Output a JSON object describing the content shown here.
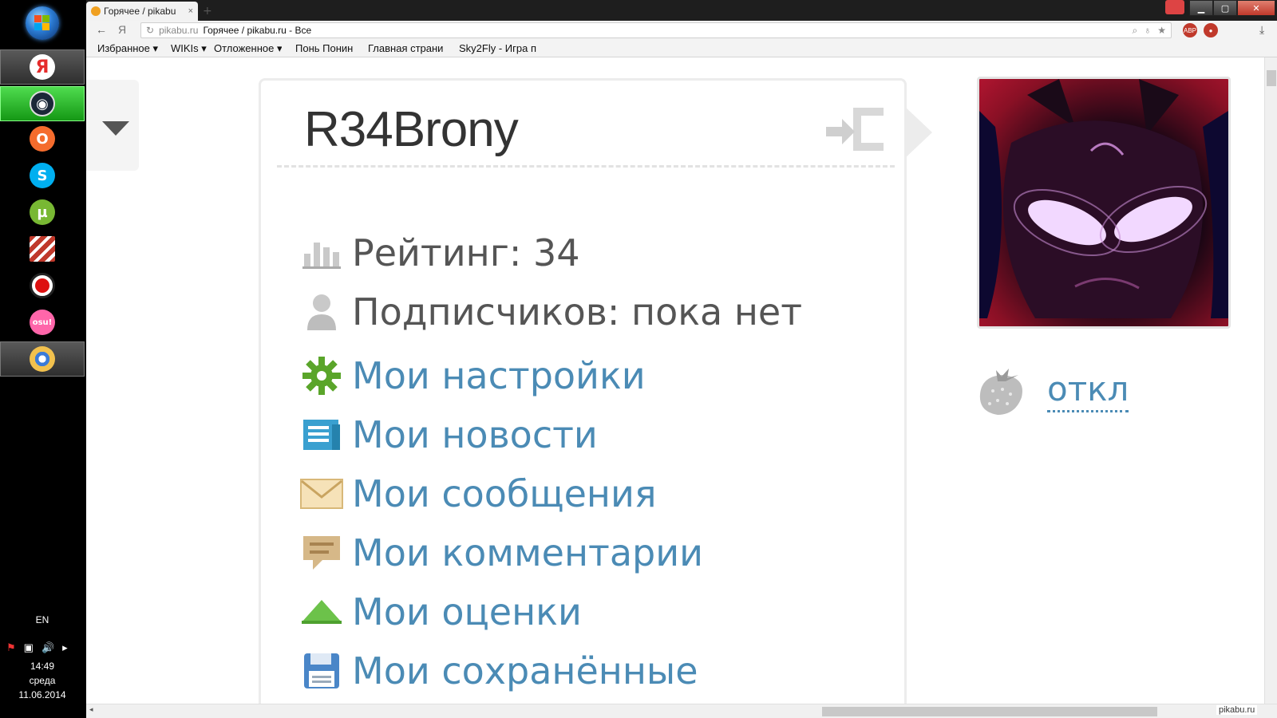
{
  "taskbar": {
    "items": [
      {
        "name": "yandex-browser",
        "glyph": "Я",
        "color": "#e52b2b"
      },
      {
        "name": "steam",
        "glyph": "S",
        "color": "#1b2838"
      },
      {
        "name": "origin",
        "glyph": "O",
        "color": "#f56c2d"
      },
      {
        "name": "skype",
        "glyph": "S",
        "color": "#00aff0"
      },
      {
        "name": "utorrent",
        "glyph": "µ",
        "color": "#78b833"
      },
      {
        "name": "stripes-app",
        "glyph": "",
        "color": "#c0392b"
      },
      {
        "name": "record-app",
        "glyph": "●",
        "color": "#d11"
      },
      {
        "name": "osu",
        "glyph": "osu!",
        "color": "#ff66aa"
      },
      {
        "name": "paint",
        "glyph": "🎨",
        "color": "#3b7bd8"
      }
    ],
    "tray": {
      "lang": "EN",
      "time": "14:49",
      "day": "среда",
      "date": "11.06.2014"
    }
  },
  "browser": {
    "tab_title": "Горячее / pikabu",
    "tab_close": "×",
    "address": {
      "domain": "pikabu.ru",
      "title": "Горячее / pikabu.ru - Все"
    },
    "bookmarks": [
      "Избранное ▾",
      "WIKIs ▾",
      "Отложенное ▾",
      "Понь Понин",
      "Главная страни",
      "Sky2Fly - Игра п"
    ]
  },
  "profile": {
    "username": "R34Brony",
    "stats": [
      {
        "icon": "bar-chart-icon",
        "text": "Рейтинг: 34"
      },
      {
        "icon": "user-icon",
        "text": "Подписчиков: пока нет"
      }
    ],
    "links": [
      {
        "icon": "gear-icon",
        "text": "Мои настройки"
      },
      {
        "icon": "news-icon",
        "text": "Мои новости"
      },
      {
        "icon": "envelope-icon",
        "text": "Мои сообщения"
      },
      {
        "icon": "comment-icon",
        "text": "Мои комментарии"
      },
      {
        "icon": "triangle-up-icon",
        "text": "Мои оценки"
      },
      {
        "icon": "floppy-icon",
        "text": "Мои сохранённые"
      }
    ],
    "strawberry_toggle": "откл"
  },
  "watermark": "pikabu.ru"
}
